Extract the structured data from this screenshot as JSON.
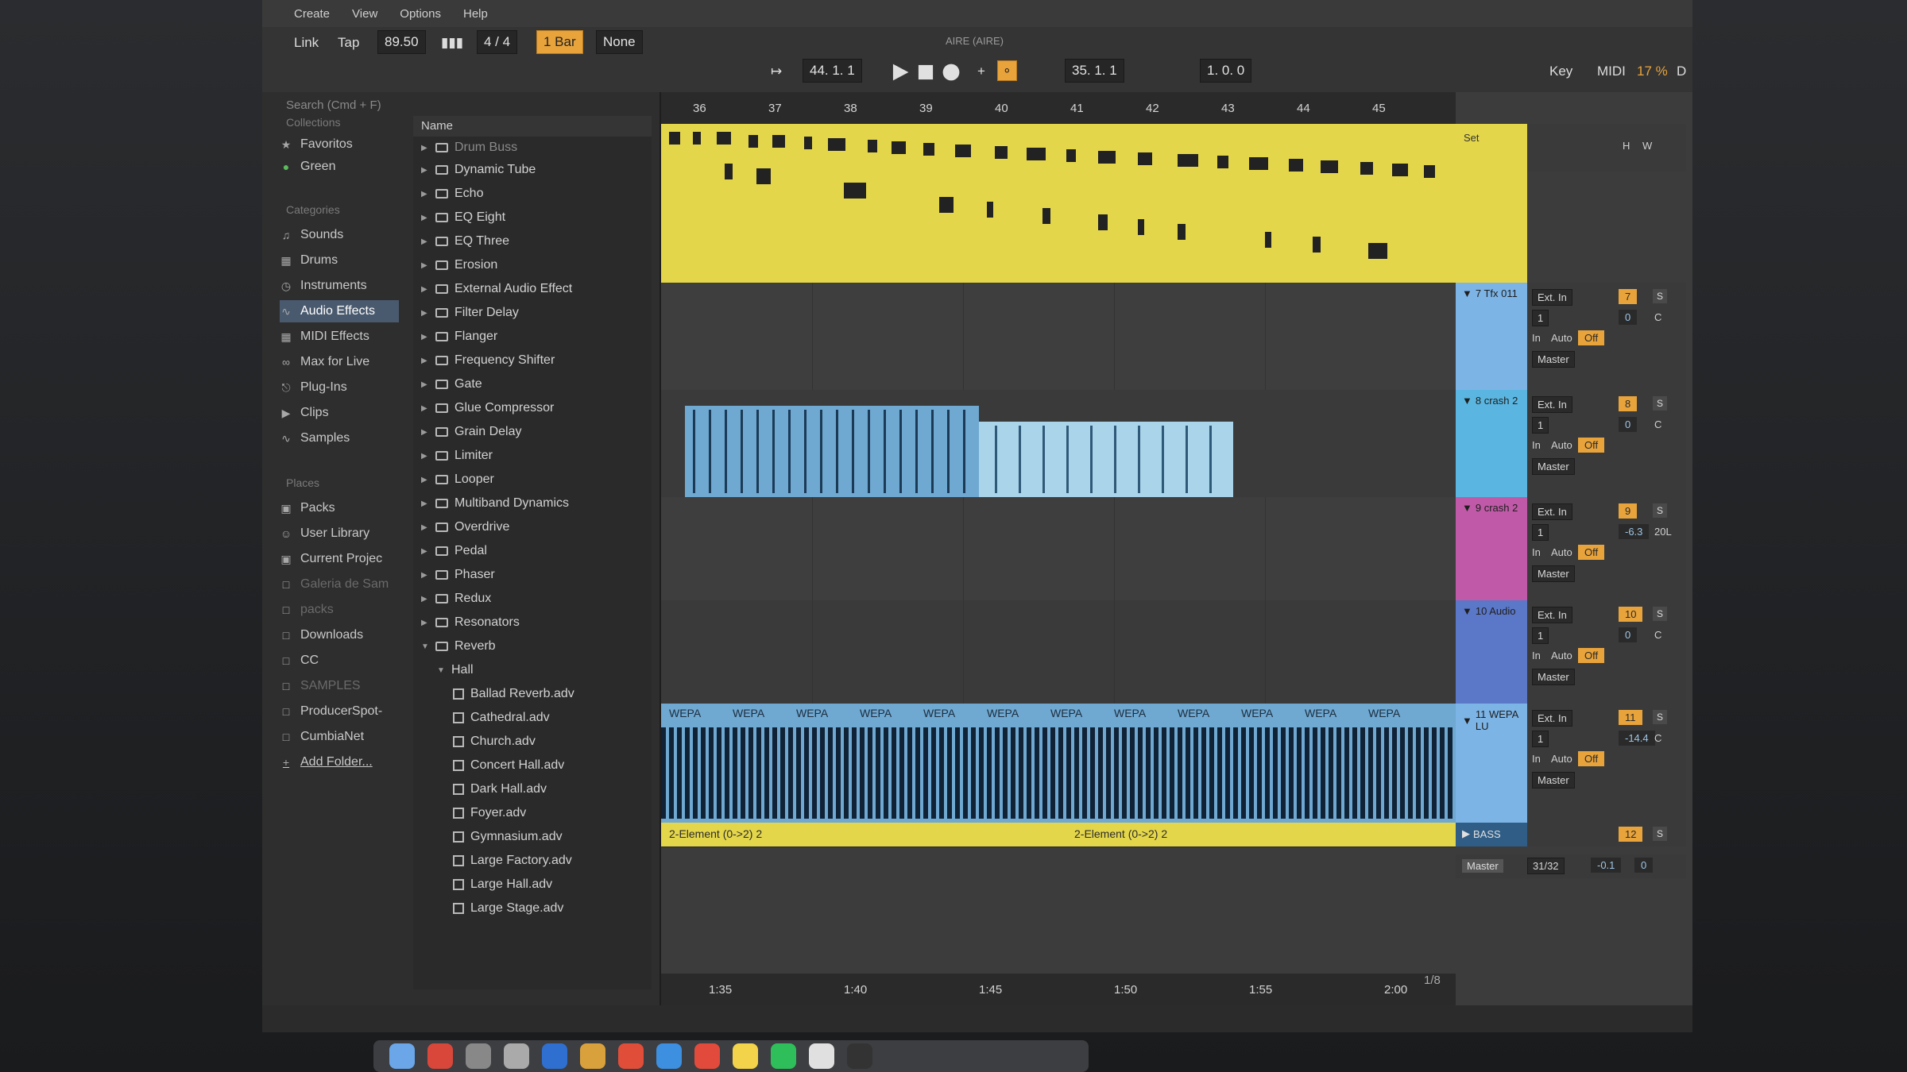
{
  "menubar": {
    "items": [
      "Create",
      "View",
      "Options",
      "Help"
    ]
  },
  "control": {
    "link": "Link",
    "tap": "Tap",
    "tempo": "89.50",
    "signature": "4 / 4",
    "loop_mode": "1 Bar",
    "quantize": "None",
    "position": "44.  1.  1",
    "loop_start": "35.  1.  1",
    "loop_length": "1.  0.  0",
    "set_name": "AIRE (AIRE)",
    "key": "Key",
    "midi": "MIDI",
    "cpu": "17 %",
    "d": "D"
  },
  "browser": {
    "search_placeholder": "Search (Cmd + F)",
    "collections_label": "Collections",
    "collections": [
      "Favoritos",
      "Green"
    ],
    "categories_label": "Categories",
    "categories": [
      "Sounds",
      "Drums",
      "Instruments",
      "Audio Effects",
      "MIDI Effects",
      "Max for Live",
      "Plug-Ins",
      "Clips",
      "Samples"
    ],
    "places_label": "Places",
    "places": [
      "Packs",
      "User Library",
      "Current Projec",
      "Galeria de Sam",
      "packs",
      "Downloads",
      "CC",
      "SAMPLES",
      "ProducerSpot-",
      "CumbiaNet",
      "Add Folder..."
    ],
    "name_header": "Name",
    "items": [
      "Drum Buss",
      "Dynamic Tube",
      "Echo",
      "EQ Eight",
      "EQ Three",
      "Erosion",
      "External Audio Effect",
      "Filter Delay",
      "Flanger",
      "Frequency Shifter",
      "Gate",
      "Glue Compressor",
      "Grain Delay",
      "Limiter",
      "Looper",
      "Multiband Dynamics",
      "Overdrive",
      "Pedal",
      "Phaser",
      "Redux",
      "Resonators",
      "Reverb"
    ],
    "reverb_sub": "Hall",
    "files": [
      "Ballad Reverb.adv",
      "Cathedral.adv",
      "Church.adv",
      "Concert Hall.adv",
      "Dark Hall.adv",
      "Foyer.adv",
      "Gymnasium.adv",
      "Large Factory.adv",
      "Large Hall.adv",
      "Large Stage.adv"
    ]
  },
  "ruler": {
    "bars": [
      "36",
      "37",
      "38",
      "39",
      "40",
      "41",
      "42",
      "43",
      "44",
      "45"
    ]
  },
  "timebar": {
    "times": [
      "1:35",
      "1:40",
      "1:45",
      "1:50",
      "1:55",
      "2:00"
    ],
    "grid": "1/8"
  },
  "tracks": [
    {
      "name": "7 Tfx 011",
      "color": "#7db4e6",
      "number": "7",
      "vol": "0",
      "pan": "C"
    },
    {
      "name": "8 crash 2",
      "color": "#5ab6e0",
      "number": "8",
      "vol": "0",
      "pan": "C"
    },
    {
      "name": "9 crash 2",
      "color": "#c05aa8",
      "number": "9",
      "vol": "-6.3",
      "pan": "20L"
    },
    {
      "name": "10 Audio",
      "color": "#5b77c8",
      "number": "10",
      "vol": "0",
      "pan": "C"
    },
    {
      "name": "11 WEPA LU",
      "color": "#7db4e6",
      "number": "11",
      "vol": "-14.4",
      "pan": "C"
    }
  ],
  "mixer": {
    "input": "Ext. In",
    "channel": "1",
    "in": "In",
    "auto": "Auto",
    "off": "Off",
    "out": "Master",
    "s": "S",
    "set": "Set",
    "h": "H",
    "w": "W"
  },
  "clips": {
    "wepa": "WEPA",
    "element1": "2-Element (0->2) 2",
    "element2": "2-Element (0->2) 2"
  },
  "bass_track": {
    "name": "BASS",
    "number": "12"
  },
  "master_track": {
    "name": "Master",
    "meter": "31/32",
    "vol": "-0.1",
    "val": "0"
  }
}
